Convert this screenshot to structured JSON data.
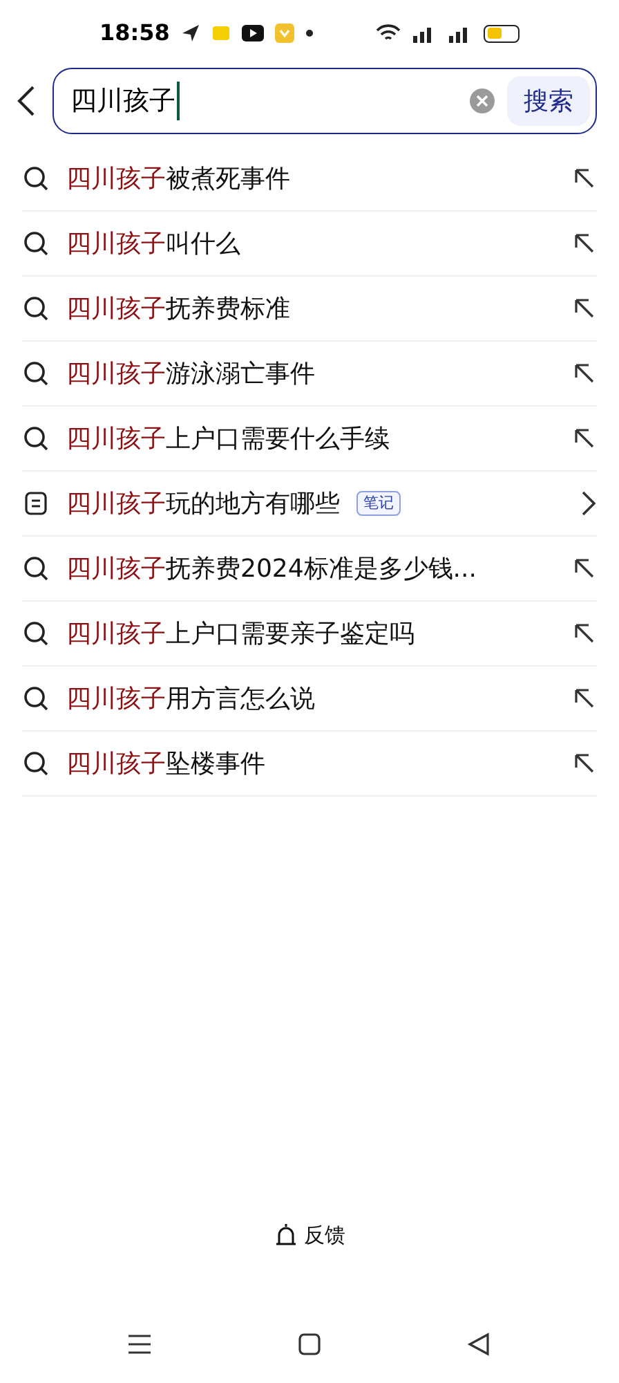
{
  "status_bar": {
    "time": "18:58"
  },
  "search": {
    "value": "四川孩子",
    "button": "搜索"
  },
  "suggestions": [
    {
      "kind": "search",
      "match": "四川孩子",
      "rest": "被煮死事件"
    },
    {
      "kind": "search",
      "match": "四川孩子",
      "rest": "叫什么"
    },
    {
      "kind": "search",
      "match": "四川孩子",
      "rest": "抚养费标准"
    },
    {
      "kind": "search",
      "match": "四川孩子",
      "rest": "游泳溺亡事件"
    },
    {
      "kind": "search",
      "match": "四川孩子",
      "rest": "上户口需要什么手续"
    },
    {
      "kind": "note",
      "match": "四川孩子",
      "rest": "玩的地方有哪些",
      "badge": "笔记"
    },
    {
      "kind": "search",
      "match": "四川孩子",
      "rest": "抚养费2024标准是多少钱..."
    },
    {
      "kind": "search",
      "match": "四川孩子",
      "rest": "上户口需要亲子鉴定吗"
    },
    {
      "kind": "search",
      "match": "四川孩子",
      "rest": "用方言怎么说"
    },
    {
      "kind": "search",
      "match": "四川孩子",
      "rest": "坠楼事件"
    }
  ],
  "feedback": "反馈"
}
